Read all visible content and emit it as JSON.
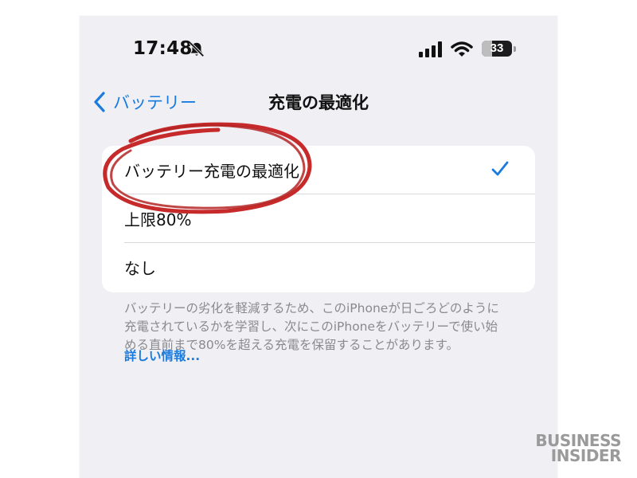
{
  "status_bar": {
    "time": "17:48",
    "battery_level": "33",
    "battery_fraction": 0.33
  },
  "nav": {
    "back_label": "バッテリー",
    "title": "充電の最適化"
  },
  "options": [
    {
      "label": "バッテリー充電の最適化",
      "selected": true
    },
    {
      "label": "上限80%",
      "selected": false
    },
    {
      "label": "なし",
      "selected": false
    }
  ],
  "footer": {
    "text": "バッテリーの劣化を軽減するため、このiPhoneが日ごろどのように充電されているかを学習し、次にこのiPhoneをバッテリーで使い始める直前まで80%を超える充電を保留することがあります。",
    "link": "詳しい情報..."
  },
  "watermark": {
    "line1": "BUSINESS",
    "line2": "INSIDER"
  },
  "colors": {
    "accent": "#1a7bde",
    "background": "#efeff4",
    "annotation": "#c62a2a"
  },
  "icons": [
    "bell-slash-icon",
    "cellular-signal-icon",
    "wifi-icon",
    "battery-icon",
    "chevron-left-icon",
    "checkmark-icon"
  ]
}
